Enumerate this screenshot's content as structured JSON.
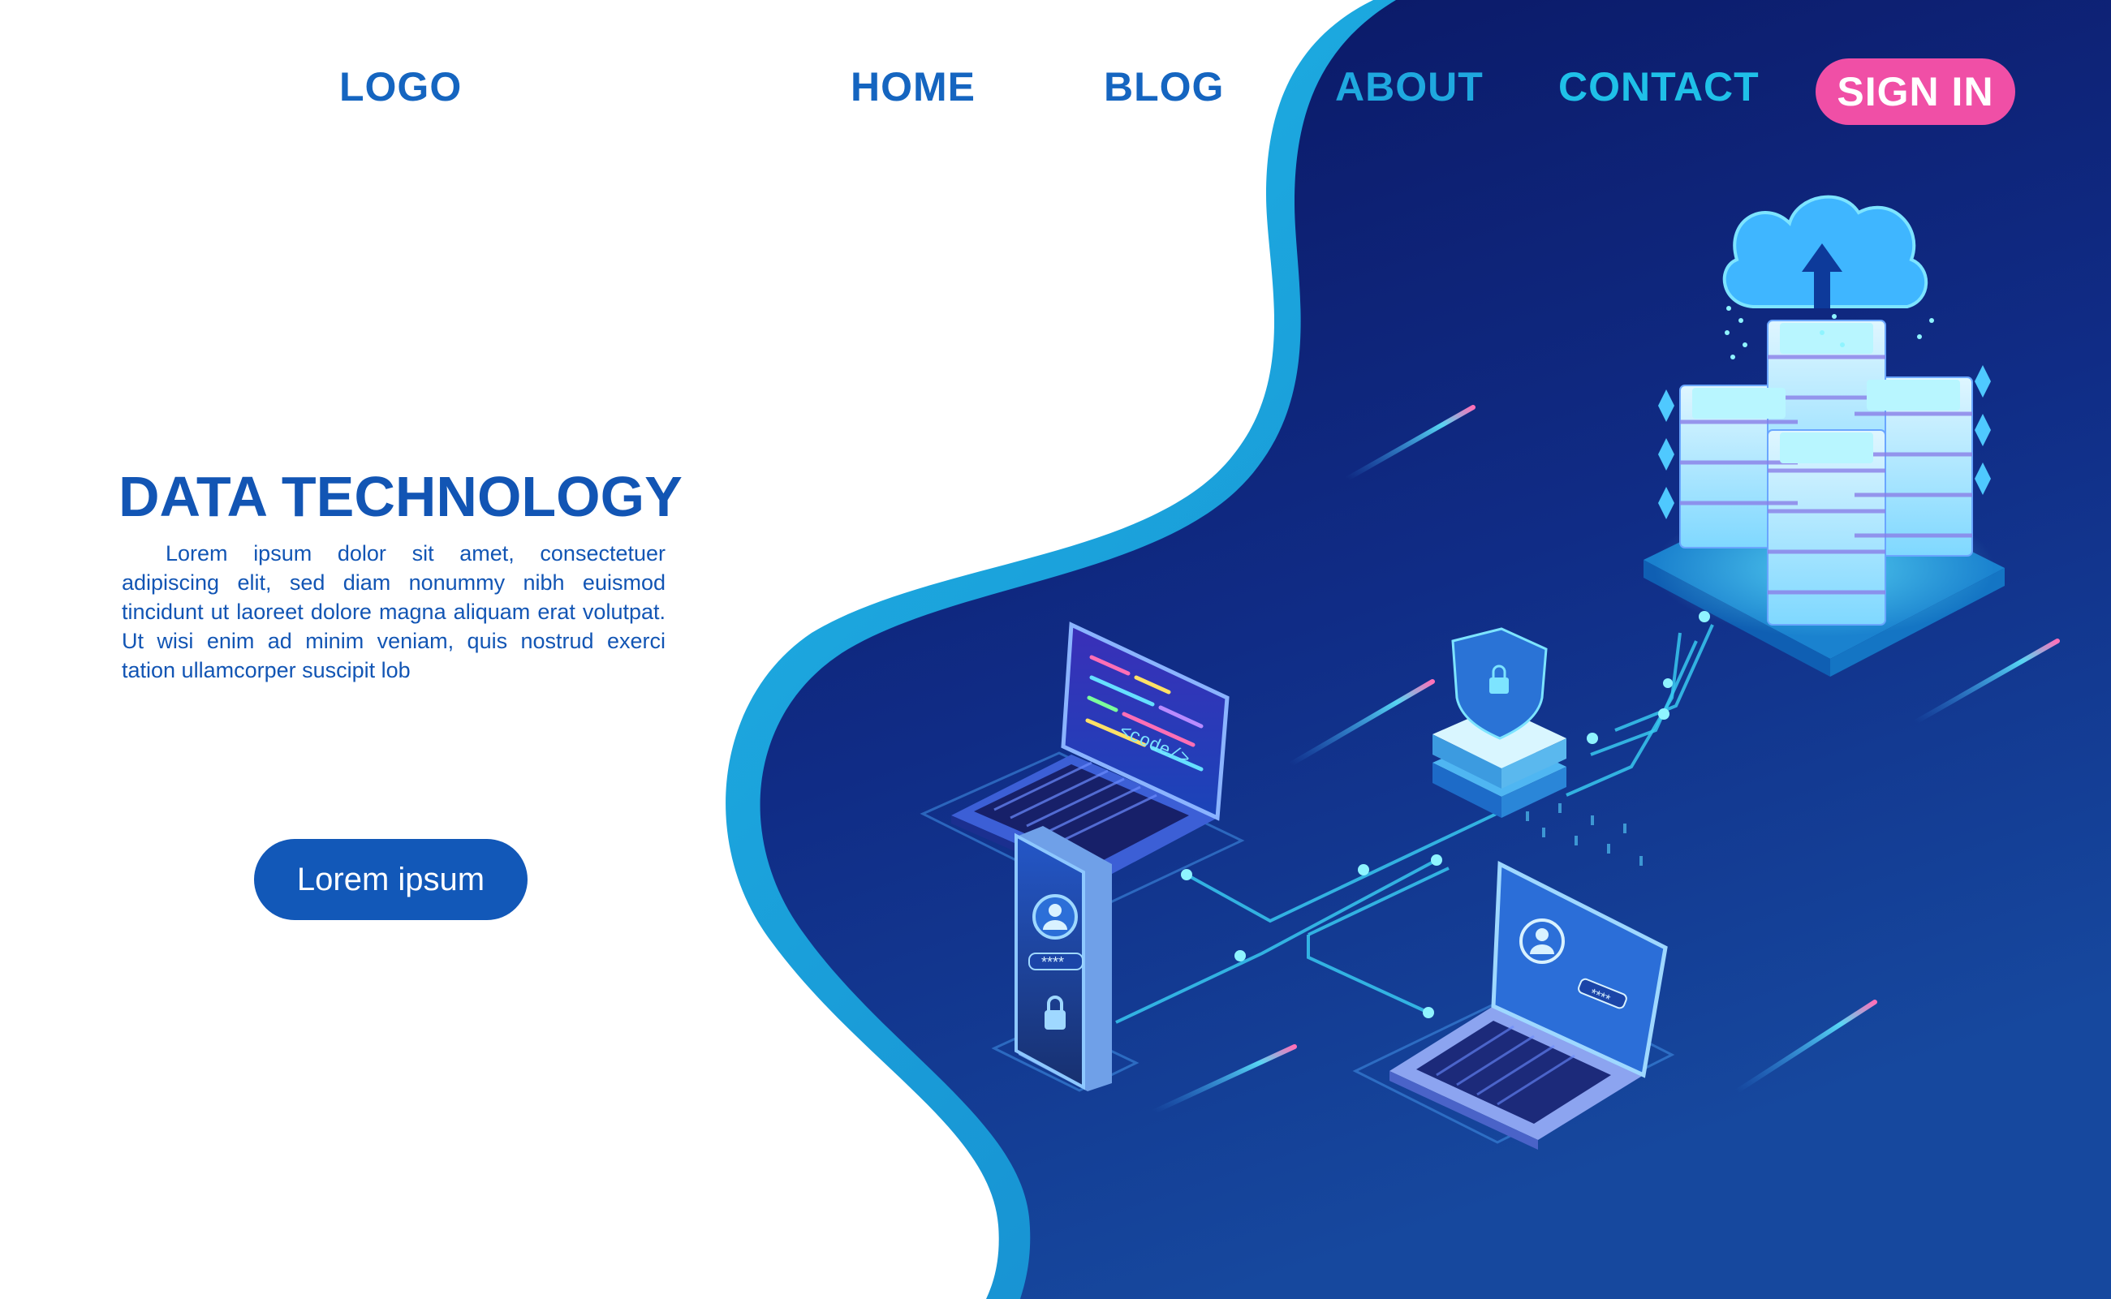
{
  "nav": {
    "logo": "LOGO",
    "home": "HOME",
    "blog": "BLOG",
    "about": "ABOUT",
    "contact": "CONTACT",
    "sign_in": "SIGN IN"
  },
  "hero": {
    "title": "DATA TECHNOLOGY",
    "body": "Lorem ipsum dolor sit amet, consectetuer adipiscing elit, sed diam nonummy nibh euismod tincidunt ut laoreet dolore magna aliquam erat volutpat. Ut wisi enim ad minim veniam, quis nostrud exerci tation ullamcorper suscipit lob",
    "cta_label": "Lorem ipsum"
  },
  "illustration": {
    "code_tag": "<code/>",
    "password_mask": "****",
    "icons": [
      "cloud-upload-icon",
      "server-rack-icon",
      "shield-lock-icon",
      "laptop-code-icon",
      "smartphone-login-icon",
      "laptop-login-icon",
      "user-icon",
      "padlock-icon"
    ]
  },
  "colors": {
    "primary_blue": "#1255b4",
    "dark_navy": "#0c1e6e",
    "wave_cyan": "#1aa3dc",
    "sign_in_pink": "#f04fa6",
    "accent_cyan": "#5fe7ff"
  }
}
